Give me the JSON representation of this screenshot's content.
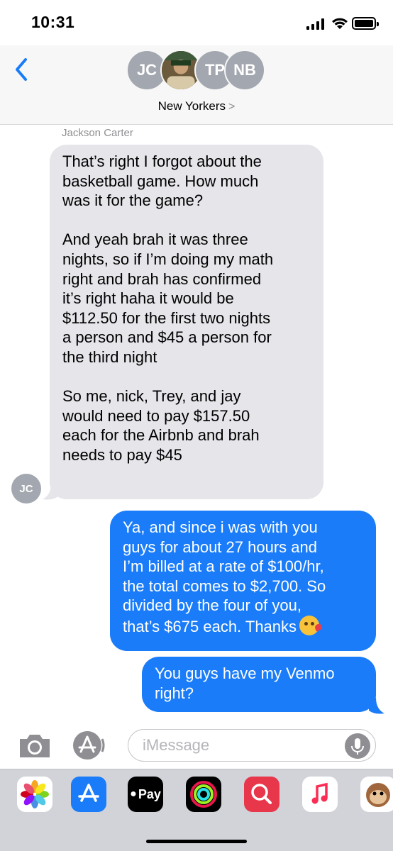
{
  "status_bar": {
    "time": "10:31"
  },
  "header": {
    "avatars": [
      {
        "initials": "JC"
      },
      {
        "initials": ""
      },
      {
        "initials": "TP"
      },
      {
        "initials": "NB"
      }
    ],
    "group_name": "New Yorkers",
    "chevron": ">"
  },
  "conversation": {
    "sender_name": "Jackson Carter",
    "sender_initials": "JC",
    "incoming_text": "That’s right I forgot about the\nbasketball game. How much\nwas it for the game?\n\nAnd yeah brah it was three\nnights, so if I’m doing my math\nright and brah has confirmed\nit’s right haha it would be\n$112.50 for the first two nights\na person and $45 a person for\nthe third night\n\nSo me, nick, Trey, and jay\nwould need to pay $157.50\neach for the Airbnb and brah\nneeds to pay $45",
    "outgoing_1": "Ya, and since i was with you\nguys for about 27 hours and\nI’m billed at a rate of $100/hr,\nthe total comes to $2,700. So\ndivided by the four of you,\nthat’s $675 each. Thanks",
    "outgoing_2": "You guys have my Venmo\nright?"
  },
  "compose": {
    "placeholder": "iMessage"
  },
  "drawer": {
    "apps": [
      "photos-icon",
      "app-store-icon",
      "apple-pay-icon",
      "activity-icon",
      "search-images-icon",
      "music-icon",
      "animoji-monkey-icon"
    ],
    "pay_label": "Pay"
  },
  "colors": {
    "outgoing": "#1a7cf9",
    "incoming": "#e5e5ea",
    "accent": "#1a7cf9"
  }
}
